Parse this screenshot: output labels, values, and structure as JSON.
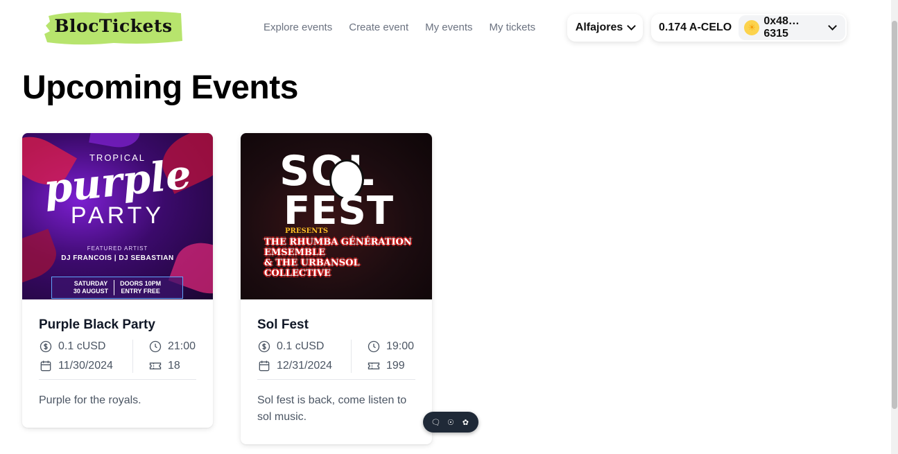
{
  "header": {
    "logo_text": "BlocTickets",
    "nav": [
      {
        "label": "Explore events"
      },
      {
        "label": "Create event"
      },
      {
        "label": "My events"
      },
      {
        "label": "My tickets"
      }
    ],
    "network": "Alfajores",
    "balance": "0.174 A-CELO",
    "address": "0x48…6315"
  },
  "page": {
    "title": "Upcoming Events"
  },
  "events": [
    {
      "title": "Purple Black Party",
      "price": "0.1 cUSD",
      "date": "11/30/2024",
      "time": "21:00",
      "tickets": "18",
      "description": "Purple for the royals.",
      "poster": {
        "line1": "TROPICAL",
        "line2": "purple",
        "line3": "PARTY",
        "featured": "FEATURED ARTIST",
        "artists": "DJ FRANCOIS | DJ SEBASTIAN",
        "date_l1": "SATURDAY",
        "date_l2": "30 AUGUST",
        "doors_l1": "DOORS 10PM",
        "doors_l2": "ENTRY FREE"
      }
    },
    {
      "title": "Sol Fest",
      "price": "0.1 cUSD",
      "date": "12/31/2024",
      "time": "19:00",
      "tickets": "199",
      "description": "Sol fest is back, come listen to sol music.",
      "poster": {
        "line1": "SOL",
        "line2": "FEST",
        "presents": "PRESENTS",
        "lineup_l1": "THE RHUMBA GÉNÉRATION",
        "lineup_l2": "EMSEMBLE",
        "lineup_l3": "& THE URBANSOL",
        "lineup_l4": "COLLECTIVE"
      }
    }
  ],
  "colors": {
    "logo_highlight": "#b7e46d",
    "text_primary": "#111827",
    "text_muted": "#4b5563",
    "nav_text": "#6b7280"
  }
}
